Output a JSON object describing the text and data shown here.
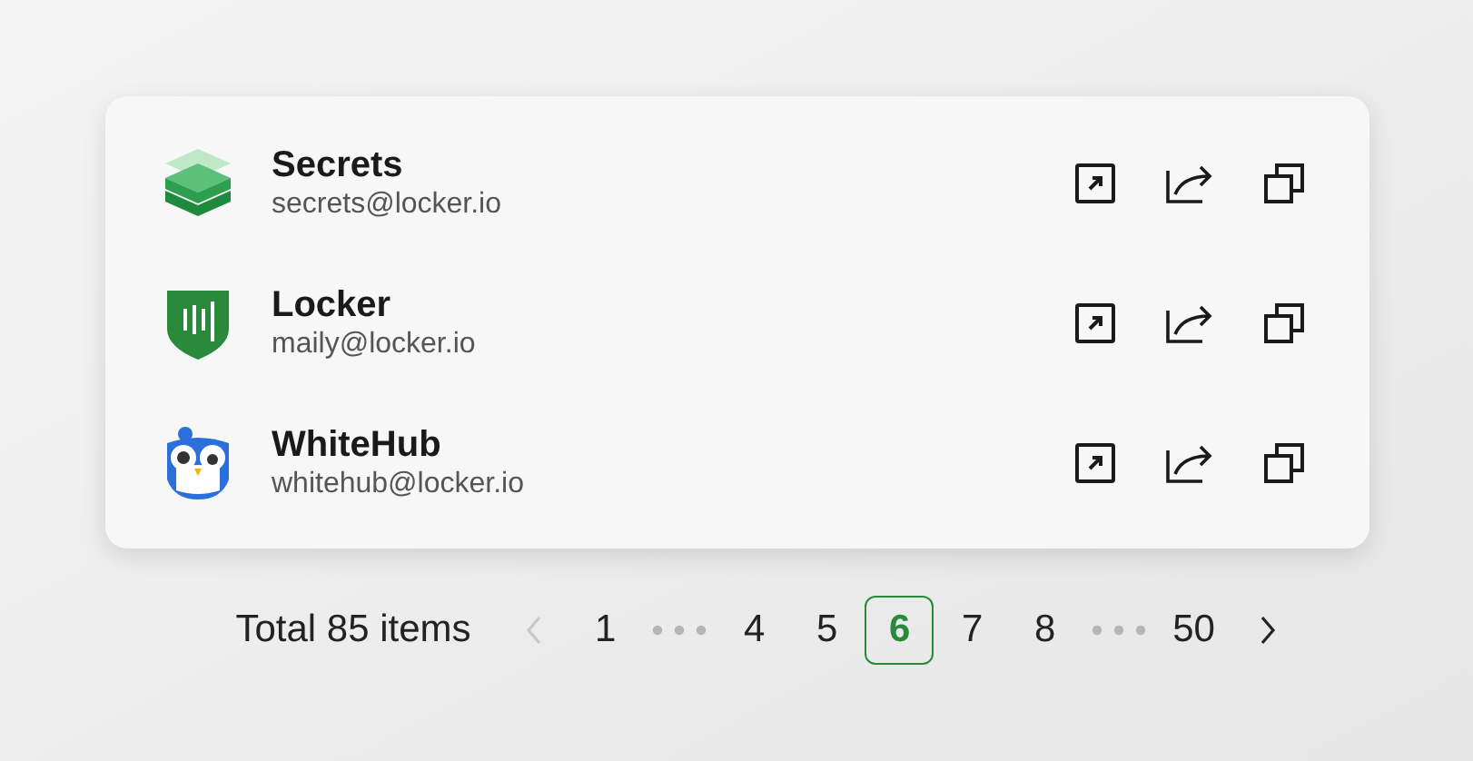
{
  "accounts": [
    {
      "name": "Secrets",
      "email": "secrets@locker.io",
      "kind": "layers"
    },
    {
      "name": "Locker",
      "email": "maily@locker.io",
      "kind": "shield"
    },
    {
      "name": "WhiteHub",
      "email": "whitehub@locker.io",
      "kind": "owl"
    }
  ],
  "pagination": {
    "total": "Total 85 items",
    "prev_disabled": true,
    "next_disabled": false,
    "pages": [
      {
        "kind": "page",
        "label": "1",
        "selected": false
      },
      {
        "kind": "ellipsis"
      },
      {
        "kind": "page",
        "label": "4",
        "selected": false
      },
      {
        "kind": "page",
        "label": "5",
        "selected": false
      },
      {
        "kind": "page",
        "label": "6",
        "selected": true
      },
      {
        "kind": "page",
        "label": "7",
        "selected": false
      },
      {
        "kind": "page",
        "label": "8",
        "selected": false
      },
      {
        "kind": "ellipsis"
      },
      {
        "kind": "page",
        "label": "50",
        "selected": false
      }
    ]
  }
}
